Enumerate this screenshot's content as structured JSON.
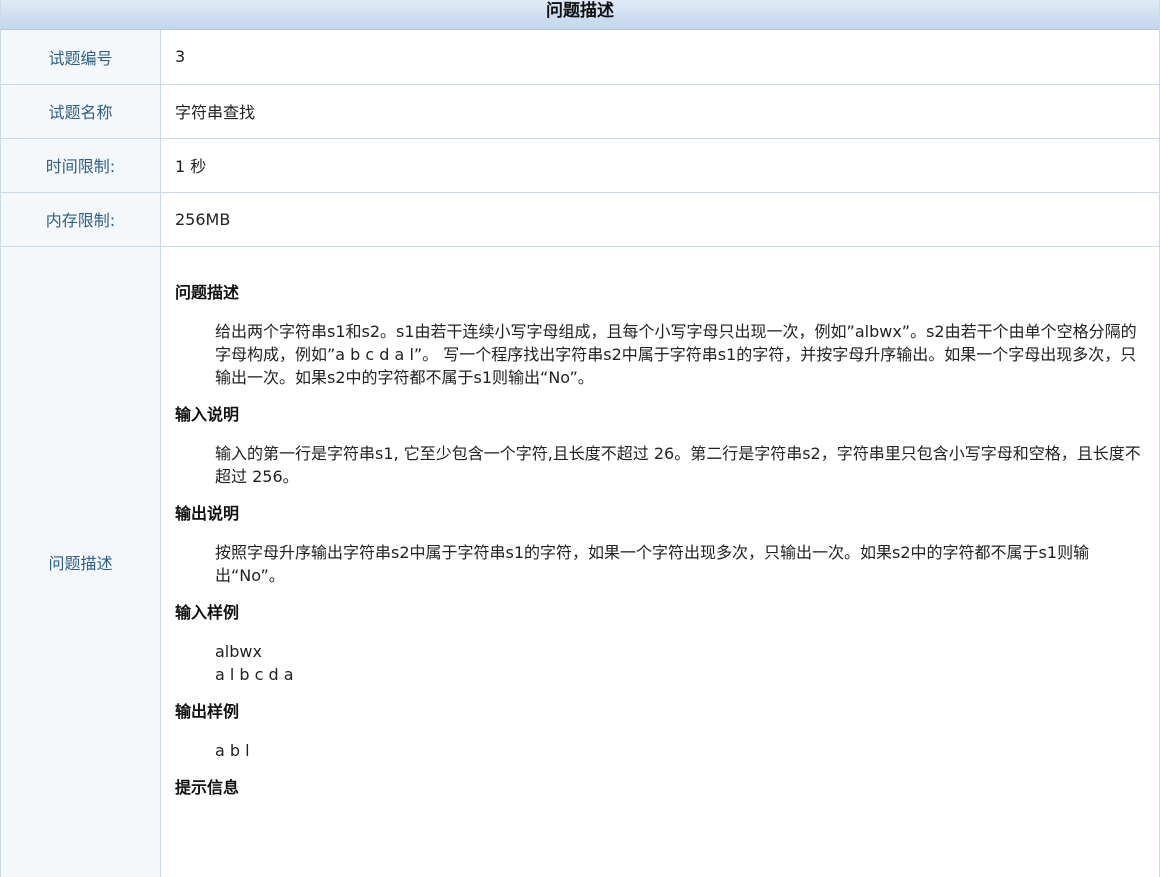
{
  "header": {
    "title": "问题描述"
  },
  "rows": [
    {
      "label": "试题编号",
      "value": "3"
    },
    {
      "label": "试题名称",
      "value": "字符串查找"
    },
    {
      "label": "时间限制:",
      "value": "1 秒"
    },
    {
      "label": "内存限制:",
      "value": "256MB"
    }
  ],
  "description": {
    "label": "问题描述",
    "sections": [
      {
        "title": "问题描述",
        "body": "给出两个字符串s1和s2。s1由若干连续小写字母组成，且每个小写字母只出现一次，例如”albwx”。s2由若干个由单个空格分隔的字母构成，例如”a b c d a l”。 写一个程序找出字符串s2中属于字符串s1的字符，并按字母升序输出。如果一个字母出现多次，只输出一次。如果s2中的字符都不属于s1则输出“No”。"
      },
      {
        "title": "输入说明",
        "body": "输入的第一行是字符串s1, 它至少包含一个字符,且长度不超过 26。第二行是字符串s2，字符串里只包含小写字母和空格，且长度不超过 256。"
      },
      {
        "title": "输出说明",
        "body": "按照字母升序输出字符串s2中属于字符串s1的字符，如果一个字符出现多次，只输出一次。如果s2中的字符都不属于s1则输出“No”。"
      },
      {
        "title": "输入样例",
        "lines": [
          "albwx",
          "a l b c d a"
        ]
      },
      {
        "title": "输出样例",
        "lines": [
          "a b l"
        ]
      },
      {
        "title": "提示信息"
      }
    ]
  }
}
